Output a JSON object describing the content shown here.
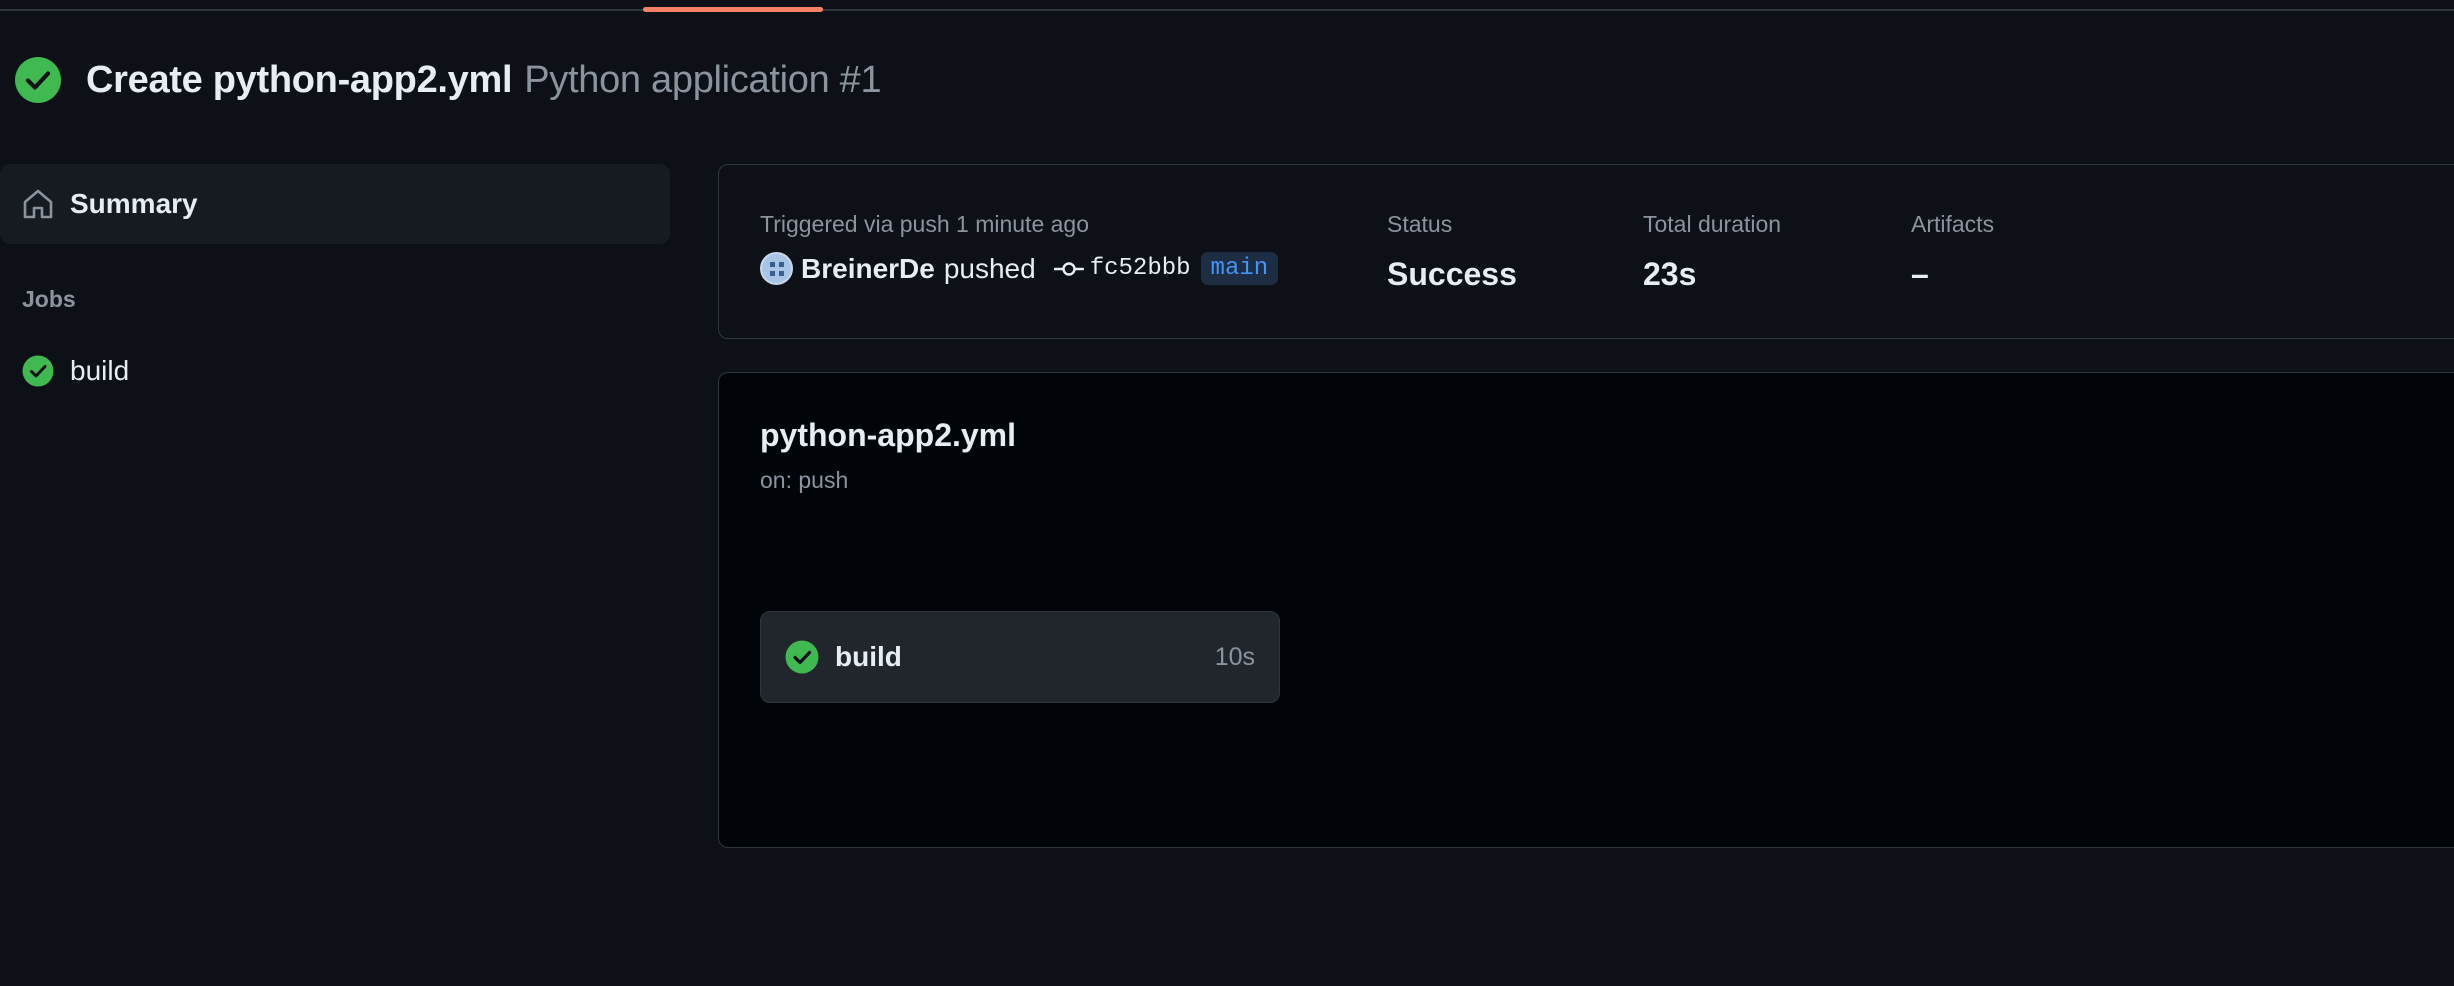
{
  "run": {
    "title": "Create python-app2.yml",
    "workflow_name": "Python application #1"
  },
  "sidebar": {
    "summary_label": "Summary",
    "jobs_heading": "Jobs",
    "jobs": [
      {
        "label": "build",
        "status": "success"
      }
    ]
  },
  "summary": {
    "trigger_label": "Triggered via push 1 minute ago",
    "actor": "BreinerDe",
    "action": "pushed",
    "commit_sha": "fc52bbb",
    "branch": "main",
    "status_label": "Status",
    "status_value": "Success",
    "duration_label": "Total duration",
    "duration_value": "23s",
    "artifacts_label": "Artifacts",
    "artifacts_value": "–"
  },
  "graph": {
    "workflow_file": "python-app2.yml",
    "trigger": "on: push",
    "jobs": [
      {
        "label": "build",
        "duration": "10s",
        "status": "success"
      }
    ]
  },
  "colors": {
    "success": "#3fb950",
    "accent_tab": "#f78166",
    "branch_text": "#4493f8",
    "background": "#0d1117"
  },
  "icons": {
    "status": "check-circle-fill-icon",
    "summary": "home-icon",
    "commit": "git-commit-icon"
  }
}
